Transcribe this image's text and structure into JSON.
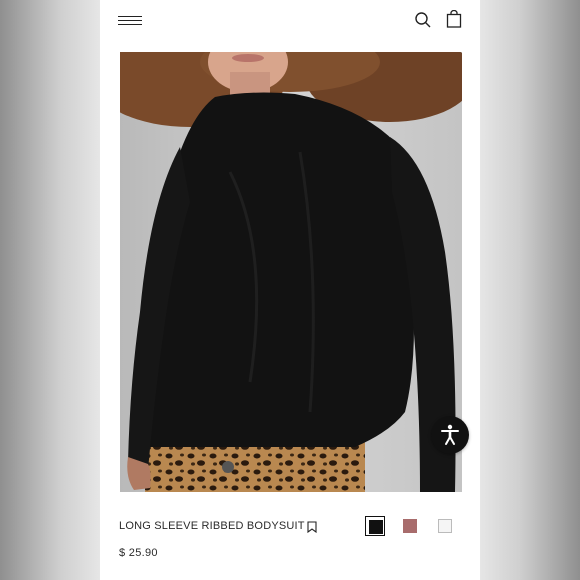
{
  "header": {
    "menu_icon": "hamburger-menu-icon",
    "search_icon": "search-icon",
    "bag_icon": "shopping-bag-icon"
  },
  "product": {
    "name": "LONG SLEEVE RIBBED BODYSUIT",
    "price": "$ 25.90",
    "bookmark_icon": "bookmark-icon",
    "colors": [
      {
        "name": "black",
        "hex": "#111111",
        "selected": true
      },
      {
        "name": "rose",
        "hex": "#a86c6c",
        "selected": false
      },
      {
        "name": "white",
        "hex": "#f5f5f5",
        "selected": false
      }
    ]
  },
  "accessibility": {
    "icon": "accessibility-icon"
  }
}
